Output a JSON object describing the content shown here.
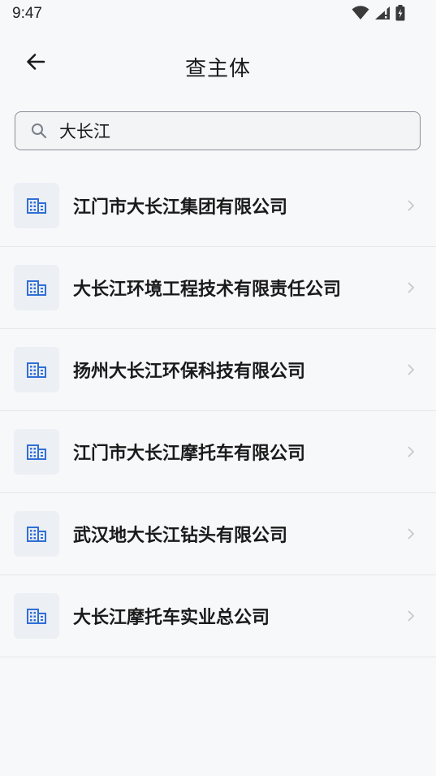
{
  "status_bar": {
    "time": "9:47",
    "icons": [
      "wifi-icon",
      "signal-icon",
      "battery-charging-icon"
    ]
  },
  "header": {
    "back_icon": "back-arrow-icon",
    "title": "查主体"
  },
  "search": {
    "value": "大长江",
    "icon": "search-icon"
  },
  "results": [
    {
      "label": "江门市大长江集团有限公司",
      "icon": "building-icon"
    },
    {
      "label": "大长江环境工程技术有限责任公司",
      "icon": "building-icon"
    },
    {
      "label": "扬州大长江环保科技有限公司",
      "icon": "building-icon"
    },
    {
      "label": "江门市大长江摩托车有限公司",
      "icon": "building-icon"
    },
    {
      "label": "武汉地大长江钻头有限公司",
      "icon": "building-icon"
    },
    {
      "label": "大长江摩托车实业总公司",
      "icon": "building-icon"
    }
  ],
  "colors": {
    "background": "#f7f8fa",
    "icon_accent": "#2f6fd6",
    "divider": "#e6e7ea"
  }
}
